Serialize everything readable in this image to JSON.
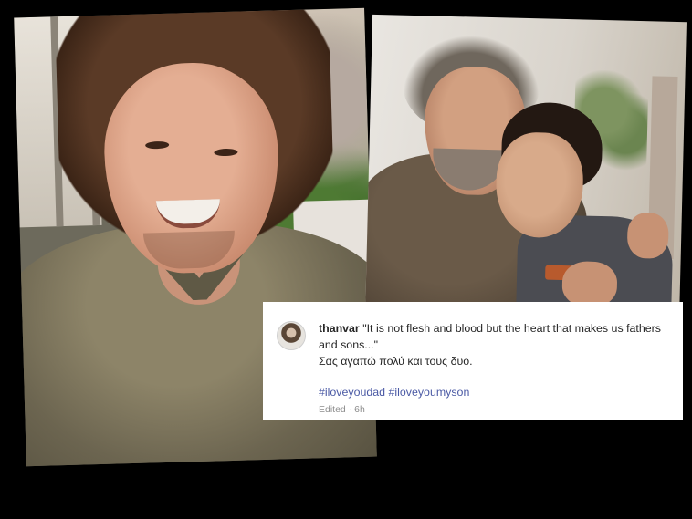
{
  "comment": {
    "username": "thanvar",
    "quote": "\"It is not flesh and blood but the heart that makes us fathers and sons...\"",
    "greek_line": "Σας αγαπώ πολύ και τους δυο.",
    "hashtags": [
      "#iloveyoudad",
      "#iloveyoumyson"
    ],
    "edited_label": "Edited",
    "separator": "·",
    "time_ago": "6h"
  },
  "photos": {
    "left": {
      "subject": "smiling-man-photo"
    },
    "right": {
      "subject": "father-son-hug-photo"
    }
  }
}
